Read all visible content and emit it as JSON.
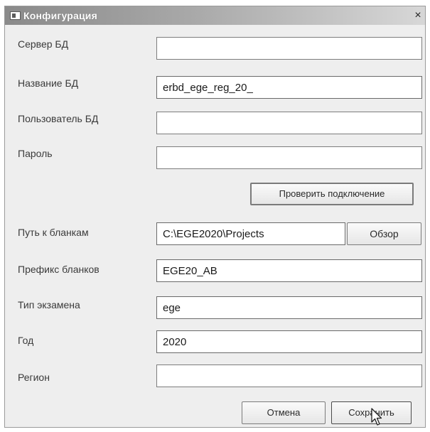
{
  "window": {
    "title": "Конфигурация",
    "close_glyph": "×",
    "app_icon": "window-app-icon",
    "close_icon": "close-icon"
  },
  "form": {
    "db_server": {
      "label": "Сервер БД",
      "value": ""
    },
    "db_name": {
      "label": "Название БД",
      "value": "erbd_ege_reg_20_"
    },
    "db_user": {
      "label": "Пользователь БД",
      "value": ""
    },
    "password": {
      "label": "Пароль",
      "value": ""
    },
    "blanks_path": {
      "label": "Путь к бланкам",
      "value": "C:\\EGE2020\\Projects"
    },
    "blank_prefix": {
      "label": "Префикс бланков",
      "value": "EGE20_AB"
    },
    "exam_type": {
      "label": "Тип экзамена",
      "value": "ege"
    },
    "year": {
      "label": "Год",
      "value": "2020"
    },
    "region": {
      "label": "Регион",
      "value": ""
    }
  },
  "buttons": {
    "check_connection": "Проверить подключение",
    "browse": "Обзор",
    "cancel": "Отмена",
    "save": "Сохранить"
  },
  "colors": {
    "titlebar_start": "#8a8a8a",
    "titlebar_end": "#d7d7d7",
    "dialog_bg": "#eeeeee",
    "field_bg": "#ffffff",
    "field_border": "#7d7d7d"
  }
}
